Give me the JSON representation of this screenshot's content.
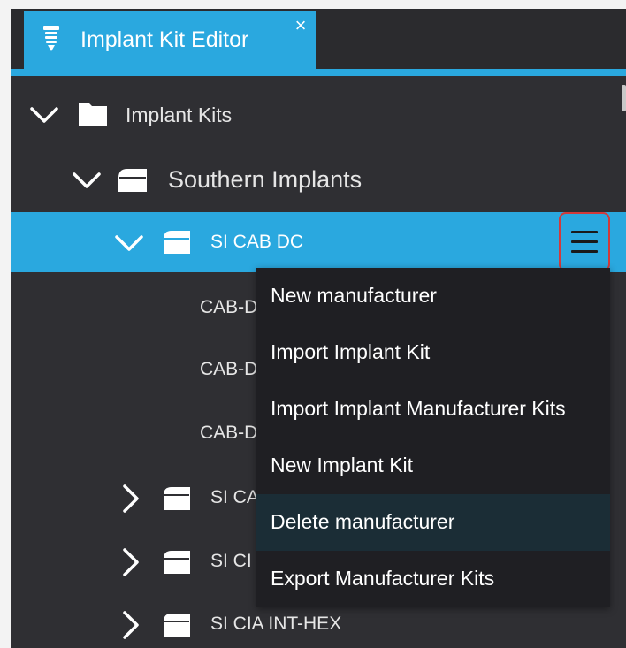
{
  "tab": {
    "title": "Implant Kit Editor",
    "close_glyph": "×",
    "icon": "implant-icon"
  },
  "tree": {
    "root": {
      "label": "Implant Kits",
      "icon": "folder-icon"
    },
    "manufacturer": {
      "label": "Southern Implants",
      "icon": "manufacturer-icon"
    },
    "selected_kit": {
      "label": "SI CAB DC",
      "icon": "kit-icon"
    },
    "kit_items": [
      {
        "label": "CAB-D"
      },
      {
        "label": "CAB-D"
      },
      {
        "label": "CAB-D"
      }
    ],
    "other_kits": [
      {
        "label": "SI CA"
      },
      {
        "label": "SI CI"
      },
      {
        "label": "SI CIA INT-HEX"
      }
    ]
  },
  "menu_button": {
    "icon": "hamburger-icon"
  },
  "context_menu": {
    "items": [
      {
        "label": "New manufacturer"
      },
      {
        "label": "Import Implant Kit"
      },
      {
        "label": "Import Implant Manufacturer Kits"
      },
      {
        "label": "New Implant Kit"
      },
      {
        "label": "Delete manufacturer"
      },
      {
        "label": "Export Manufacturer Kits"
      }
    ],
    "hovered_index": 4
  },
  "colors": {
    "accent": "#2aa8df",
    "panel_bg": "#2f2f33",
    "menu_bg": "#1f1f23",
    "menu_hover": "#1b2d36",
    "highlight_border": "#d23a3a"
  }
}
